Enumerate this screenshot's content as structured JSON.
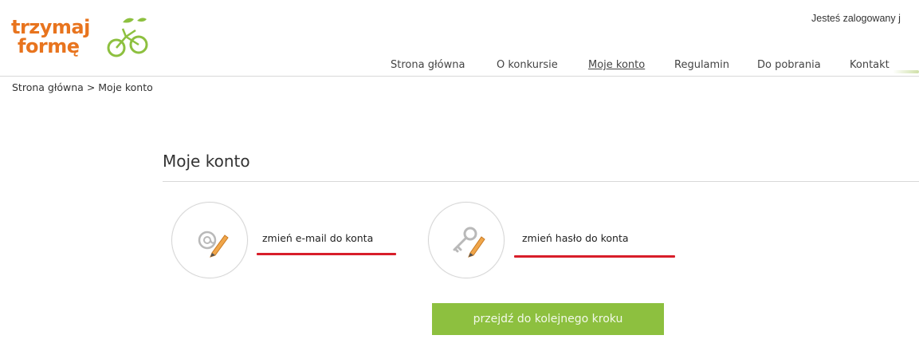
{
  "header": {
    "logo_text_line1": "trzymaj",
    "logo_text_line2": "formę",
    "logged_in_text": "Jesteś zalogowany j"
  },
  "nav": {
    "items": [
      {
        "label": "Strona główna"
      },
      {
        "label": "O konkursie"
      },
      {
        "label": "Moje konto",
        "active": true
      },
      {
        "label": "Regulamin"
      },
      {
        "label": "Do pobrania"
      },
      {
        "label": "Kontakt"
      }
    ]
  },
  "breadcrumb": {
    "home": "Strona główna",
    "separator": " > ",
    "current": "Moje konto"
  },
  "main": {
    "title": "Moje konto",
    "options": [
      {
        "label": "zmień e-mail do konta",
        "icon": "email-edit-icon"
      },
      {
        "label": "zmień hasło do konta",
        "icon": "key-edit-icon"
      }
    ],
    "next_button": "przejdź do kolejnego kroku"
  },
  "colors": {
    "logo_orange": "#e8741e",
    "logo_green": "#8dc03f",
    "button_green": "#8dc03f",
    "highlight_red": "#d81e2a"
  }
}
